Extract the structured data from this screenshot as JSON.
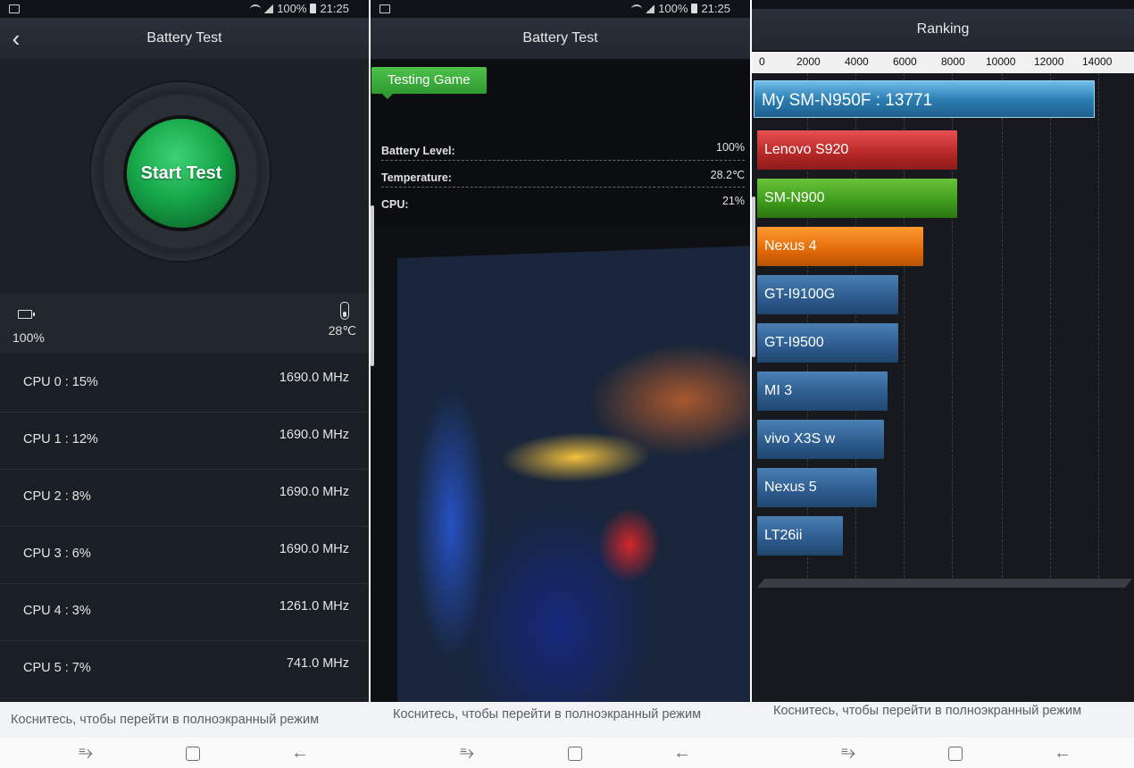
{
  "status_bar": {
    "battery": "100%",
    "time": "21:25"
  },
  "panel1": {
    "title": "Battery Test",
    "start_button": "Start Test",
    "battery_pct": "100%",
    "temperature": "28℃",
    "cpus": [
      {
        "name": "CPU  0 : 15%",
        "freq": "1690.0 MHz"
      },
      {
        "name": "CPU  1 : 12%",
        "freq": "1690.0 MHz"
      },
      {
        "name": "CPU  2 : 8%",
        "freq": "1690.0 MHz"
      },
      {
        "name": "CPU  3 : 6%",
        "freq": "1690.0 MHz"
      },
      {
        "name": "CPU  4 : 3%",
        "freq": "1261.0 MHz"
      },
      {
        "name": "CPU  5 : 7%",
        "freq": "741.0 MHz"
      }
    ]
  },
  "panel2": {
    "title": "Battery Test",
    "tag": "Testing Game",
    "stats": [
      {
        "label": "Battery Level:",
        "value": "100%"
      },
      {
        "label": "Temperature:",
        "value": "28.2℃"
      },
      {
        "label": "CPU:",
        "value": "21%"
      }
    ]
  },
  "panel3": {
    "title": "Ranking",
    "axis_ticks": [
      "0",
      "2000",
      "4000",
      "6000",
      "8000",
      "10000",
      "12000",
      "14000"
    ],
    "entries": [
      {
        "label": "My SM-N950F :  13771",
        "style": "mine"
      },
      {
        "label": "Lenovo S920",
        "style": "red"
      },
      {
        "label": "SM-N900",
        "style": "green"
      },
      {
        "label": "Nexus 4",
        "style": "orange"
      },
      {
        "label": "GT-I9100G",
        "style": "blue"
      },
      {
        "label": "GT-I9500",
        "style": "blue"
      },
      {
        "label": "MI 3",
        "style": "blue"
      },
      {
        "label": "vivo X3S w",
        "style": "blue"
      },
      {
        "label": "Nexus 5",
        "style": "blue"
      },
      {
        "label": "LT26ii",
        "style": "blue"
      }
    ]
  },
  "hint_text": "Коснитесь, чтобы перейти в полноэкранный режим"
}
